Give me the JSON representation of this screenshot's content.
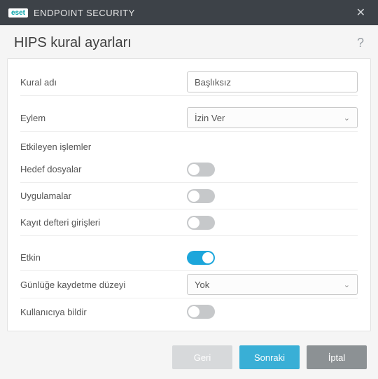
{
  "titlebar": {
    "brand_logo": "eset",
    "brand_text": "ENDPOINT SECURITY"
  },
  "header": {
    "title": "HIPS kural ayarları"
  },
  "form": {
    "rule_name": {
      "label": "Kural adı",
      "value": "Başlıksız"
    },
    "action": {
      "label": "Eylem",
      "selected": "İzin Ver"
    },
    "affecting_section": "Etkileyen işlemler",
    "target_files": {
      "label": "Hedef dosyalar",
      "on": false
    },
    "applications": {
      "label": "Uygulamalar",
      "on": false
    },
    "registry_entries": {
      "label": "Kayıt defteri girişleri",
      "on": false
    },
    "enabled": {
      "label": "Etkin",
      "on": true
    },
    "log_level": {
      "label": "Günlüğe kaydetme düzeyi",
      "selected": "Yok"
    },
    "notify_user": {
      "label": "Kullanıcıya bildir",
      "on": false
    }
  },
  "footer": {
    "back": "Geri",
    "next": "Sonraki",
    "cancel": "İptal"
  }
}
